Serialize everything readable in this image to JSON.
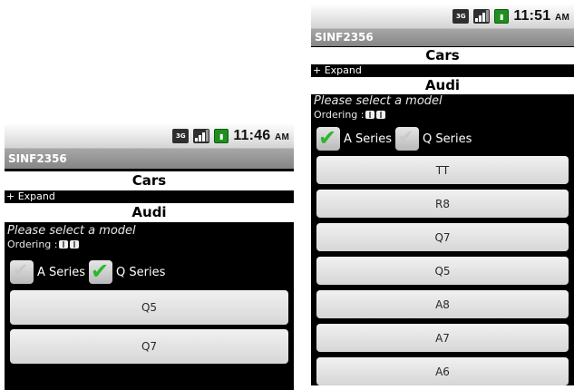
{
  "left": {
    "status": {
      "time": "11:46",
      "ampm": "AM",
      "net": "3G"
    },
    "app_title": "SINF2356",
    "category": "Cars",
    "expand_label": "+ Expand",
    "brand": "Audi",
    "prompt": "Please select a model",
    "ordering_label": "Ordering :",
    "checkboxes": [
      {
        "label": "A Series",
        "checked": false
      },
      {
        "label": "Q Series",
        "checked": true
      }
    ],
    "models": [
      "Q5",
      "Q7"
    ]
  },
  "right": {
    "status": {
      "time": "11:51",
      "ampm": "AM",
      "net": "3G"
    },
    "app_title": "SINF2356",
    "category": "Cars",
    "expand_label": "+ Expand",
    "brand": "Audi",
    "prompt": "Please select a model",
    "ordering_label": "Ordering :",
    "checkboxes": [
      {
        "label": "A Series",
        "checked": true
      },
      {
        "label": "Q Series",
        "checked": false
      }
    ],
    "models": [
      "TT",
      "R8",
      "Q7",
      "Q5",
      "A8",
      "A7",
      "A6"
    ]
  }
}
